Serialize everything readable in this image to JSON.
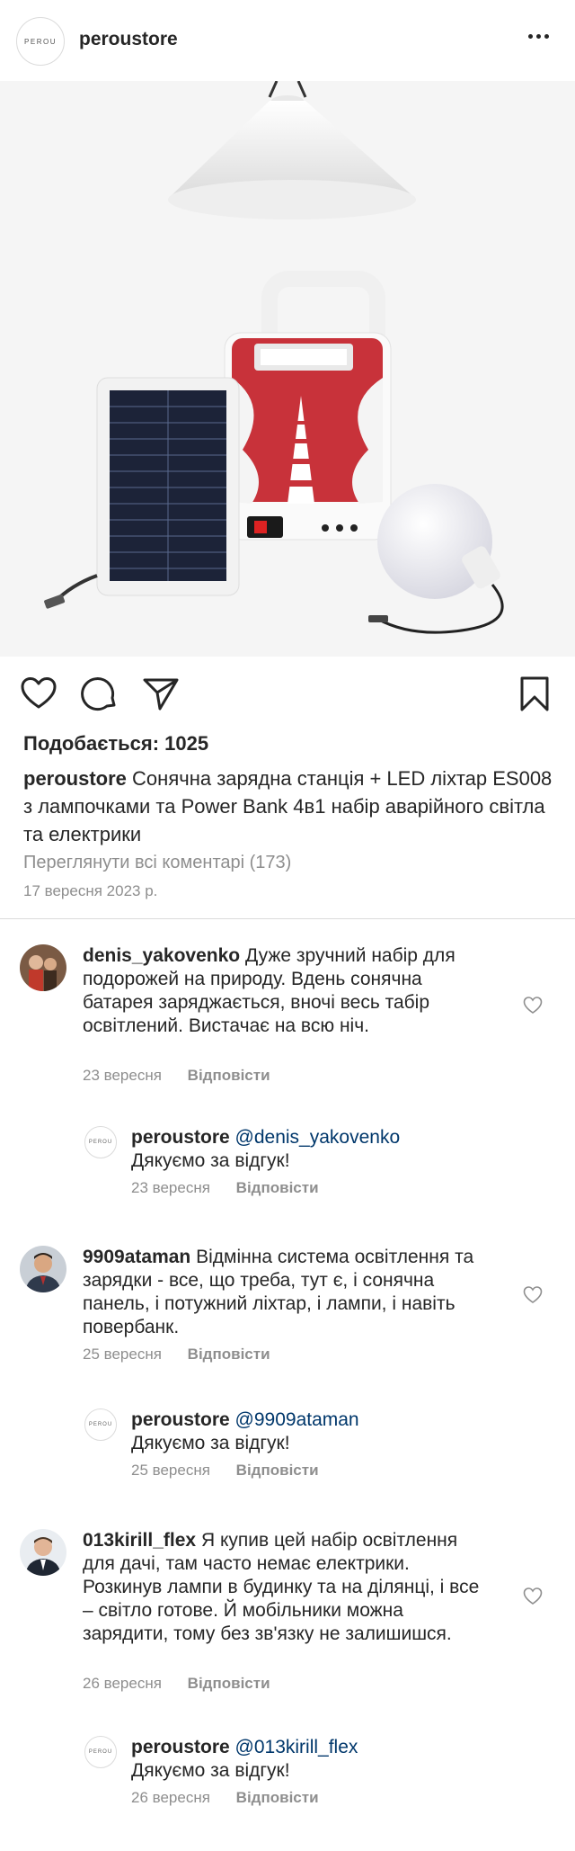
{
  "header": {
    "avatar_text": "PEROU",
    "username": "peroustore"
  },
  "post": {
    "likes_label": "Подобається:",
    "likes_count": "1025",
    "caption_user": "peroustore",
    "caption_text": "Сонячна зарядна станція + LED ліхтар ES008 з лампочками та Power Bank 4в1 набір аварійного світла та електрики",
    "view_all_comments": "Переглянути всі коментарі (173)",
    "date": "17 вересня 2023 р."
  },
  "comments": [
    {
      "username": "denis_yakovenko",
      "text": "Дуже зручний набір для подорожей на природу. Вдень сонячна батарея заряджається, вночі весь табір освітлений. Вистачає на всю ніч.",
      "date": "23 вересня",
      "reply_label": "Відповісти",
      "reply": {
        "username": "peroustore",
        "mention": "@denis_yakovenko",
        "text": "Дякуємо за відгук!",
        "date": "23 вересня",
        "reply_label": "Відповісти"
      }
    },
    {
      "username": "9909ataman",
      "text": "Відмінна система освітлення та зарядки - все, що треба, тут є, і сонячна панель, і потужний ліхтар, і лампи, і навіть повербанк.",
      "date": "25 вересня",
      "reply_label": "Відповісти",
      "reply": {
        "username": "peroustore",
        "mention": "@9909ataman",
        "text": "Дякуємо за відгук!",
        "date": "25 вересня",
        "reply_label": "Відповісти"
      }
    },
    {
      "username": "013kirill_flex",
      "text": "Я купив цей набір освітлення для дачі, там часто немає електрики. Розкинув лампи в будинку та на ділянці, і все – світло готове. Й мобільники можна зарядити, тому без зв'язку не залишишся.",
      "date": "26 вересня",
      "reply_label": "Відповісти",
      "reply": {
        "username": "peroustore",
        "mention": "@013kirill_flex",
        "text": "Дякуємо за відгук!",
        "date": "26 вересня",
        "reply_label": "Відповісти"
      }
    }
  ],
  "colors": {
    "text": "#262626",
    "muted": "#8e8e8e",
    "mention": "#00376b",
    "product_red": "#c8323a"
  },
  "icons": [
    "more-icon",
    "heart-icon",
    "comment-icon",
    "share-icon",
    "bookmark-icon",
    "comment-heart-icon"
  ]
}
